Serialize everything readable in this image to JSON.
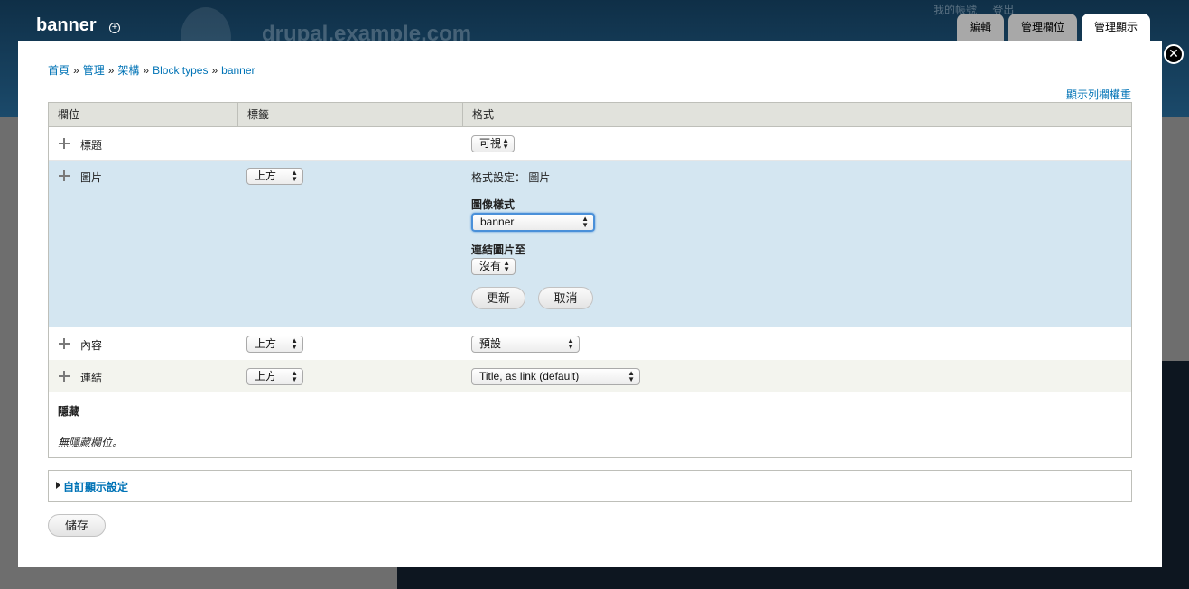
{
  "background": {
    "site_name": "drupal.example.com",
    "user_links": [
      "我的帳號",
      "登出"
    ]
  },
  "overlay": {
    "title": "banner",
    "shortcut_icon": "plus-circle-icon",
    "close_icon": "close-icon"
  },
  "tabs": [
    {
      "label": "編輯",
      "active": false
    },
    {
      "label": "管理欄位",
      "active": false
    },
    {
      "label": "管理顯示",
      "active": true
    }
  ],
  "breadcrumb": [
    "首頁",
    "管理",
    "架構",
    "Block types",
    "banner"
  ],
  "breadcrumb_separator": "»",
  "weights_link": "顯示列欄權重",
  "table": {
    "headers": [
      "欄位",
      "標籤",
      "格式"
    ],
    "rows": [
      {
        "field": "標題",
        "label": null,
        "format": "可視"
      },
      {
        "field": "圖片",
        "label": "上方",
        "format_settings": {
          "heading": "格式設定：",
          "heading_value": "圖片",
          "image_style_label": "圖像樣式",
          "image_style_value": "banner",
          "link_label": "連結圖片至",
          "link_value": "沒有",
          "update_button": "更新",
          "cancel_button": "取消"
        }
      },
      {
        "field": "內容",
        "label": "上方",
        "format": "預設"
      },
      {
        "field": "連結",
        "label": "上方",
        "format": "Title, as link (default)"
      }
    ],
    "hidden_heading": "隱藏",
    "hidden_empty": "無隱藏欄位。"
  },
  "custom_display": {
    "label": "自訂顯示設定"
  },
  "save_button": "儲存",
  "colors": {
    "link": "#0073b6",
    "highlight_row": "#d4e6f1",
    "even_row": "#f3f4ee",
    "header_bg": "#e1e2dc"
  }
}
